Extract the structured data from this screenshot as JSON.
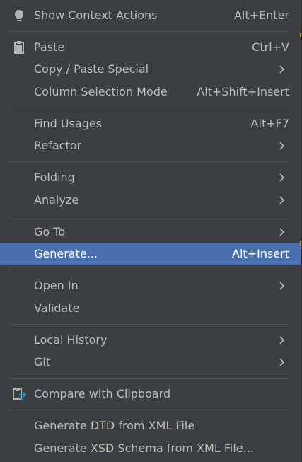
{
  "menu": {
    "show_context_actions": {
      "label": "Show Context Actions",
      "shortcut": "Alt+Enter",
      "icon": "lightbulb-icon"
    },
    "paste": {
      "label": "Paste",
      "shortcut": "Ctrl+V",
      "icon": "clipboard-icon"
    },
    "copy_paste_special": {
      "label": "Copy / Paste Special"
    },
    "column_selection_mode": {
      "label": "Column Selection Mode",
      "shortcut": "Alt+Shift+Insert"
    },
    "find_usages": {
      "label": "Find Usages",
      "shortcut": "Alt+F7"
    },
    "refactor": {
      "label": "Refactor"
    },
    "folding": {
      "label": "Folding"
    },
    "analyze": {
      "label": "Analyze"
    },
    "go_to": {
      "label": "Go To"
    },
    "generate": {
      "label": "Generate...",
      "shortcut": "Alt+Insert"
    },
    "open_in": {
      "label": "Open In"
    },
    "validate": {
      "label": "Validate"
    },
    "local_history": {
      "label": "Local History"
    },
    "git": {
      "label": "Git"
    },
    "compare_with_clipboard": {
      "label": "Compare with Clipboard",
      "icon": "compare-clipboard-icon"
    },
    "generate_dtd": {
      "label": "Generate DTD from XML File"
    },
    "generate_xsd": {
      "label": "Generate XSD Schema from XML File..."
    }
  },
  "colors": {
    "background": "#3c3f41",
    "text": "#bbbbbb",
    "selected_background": "#4b6eaf",
    "separator": "#515151"
  }
}
